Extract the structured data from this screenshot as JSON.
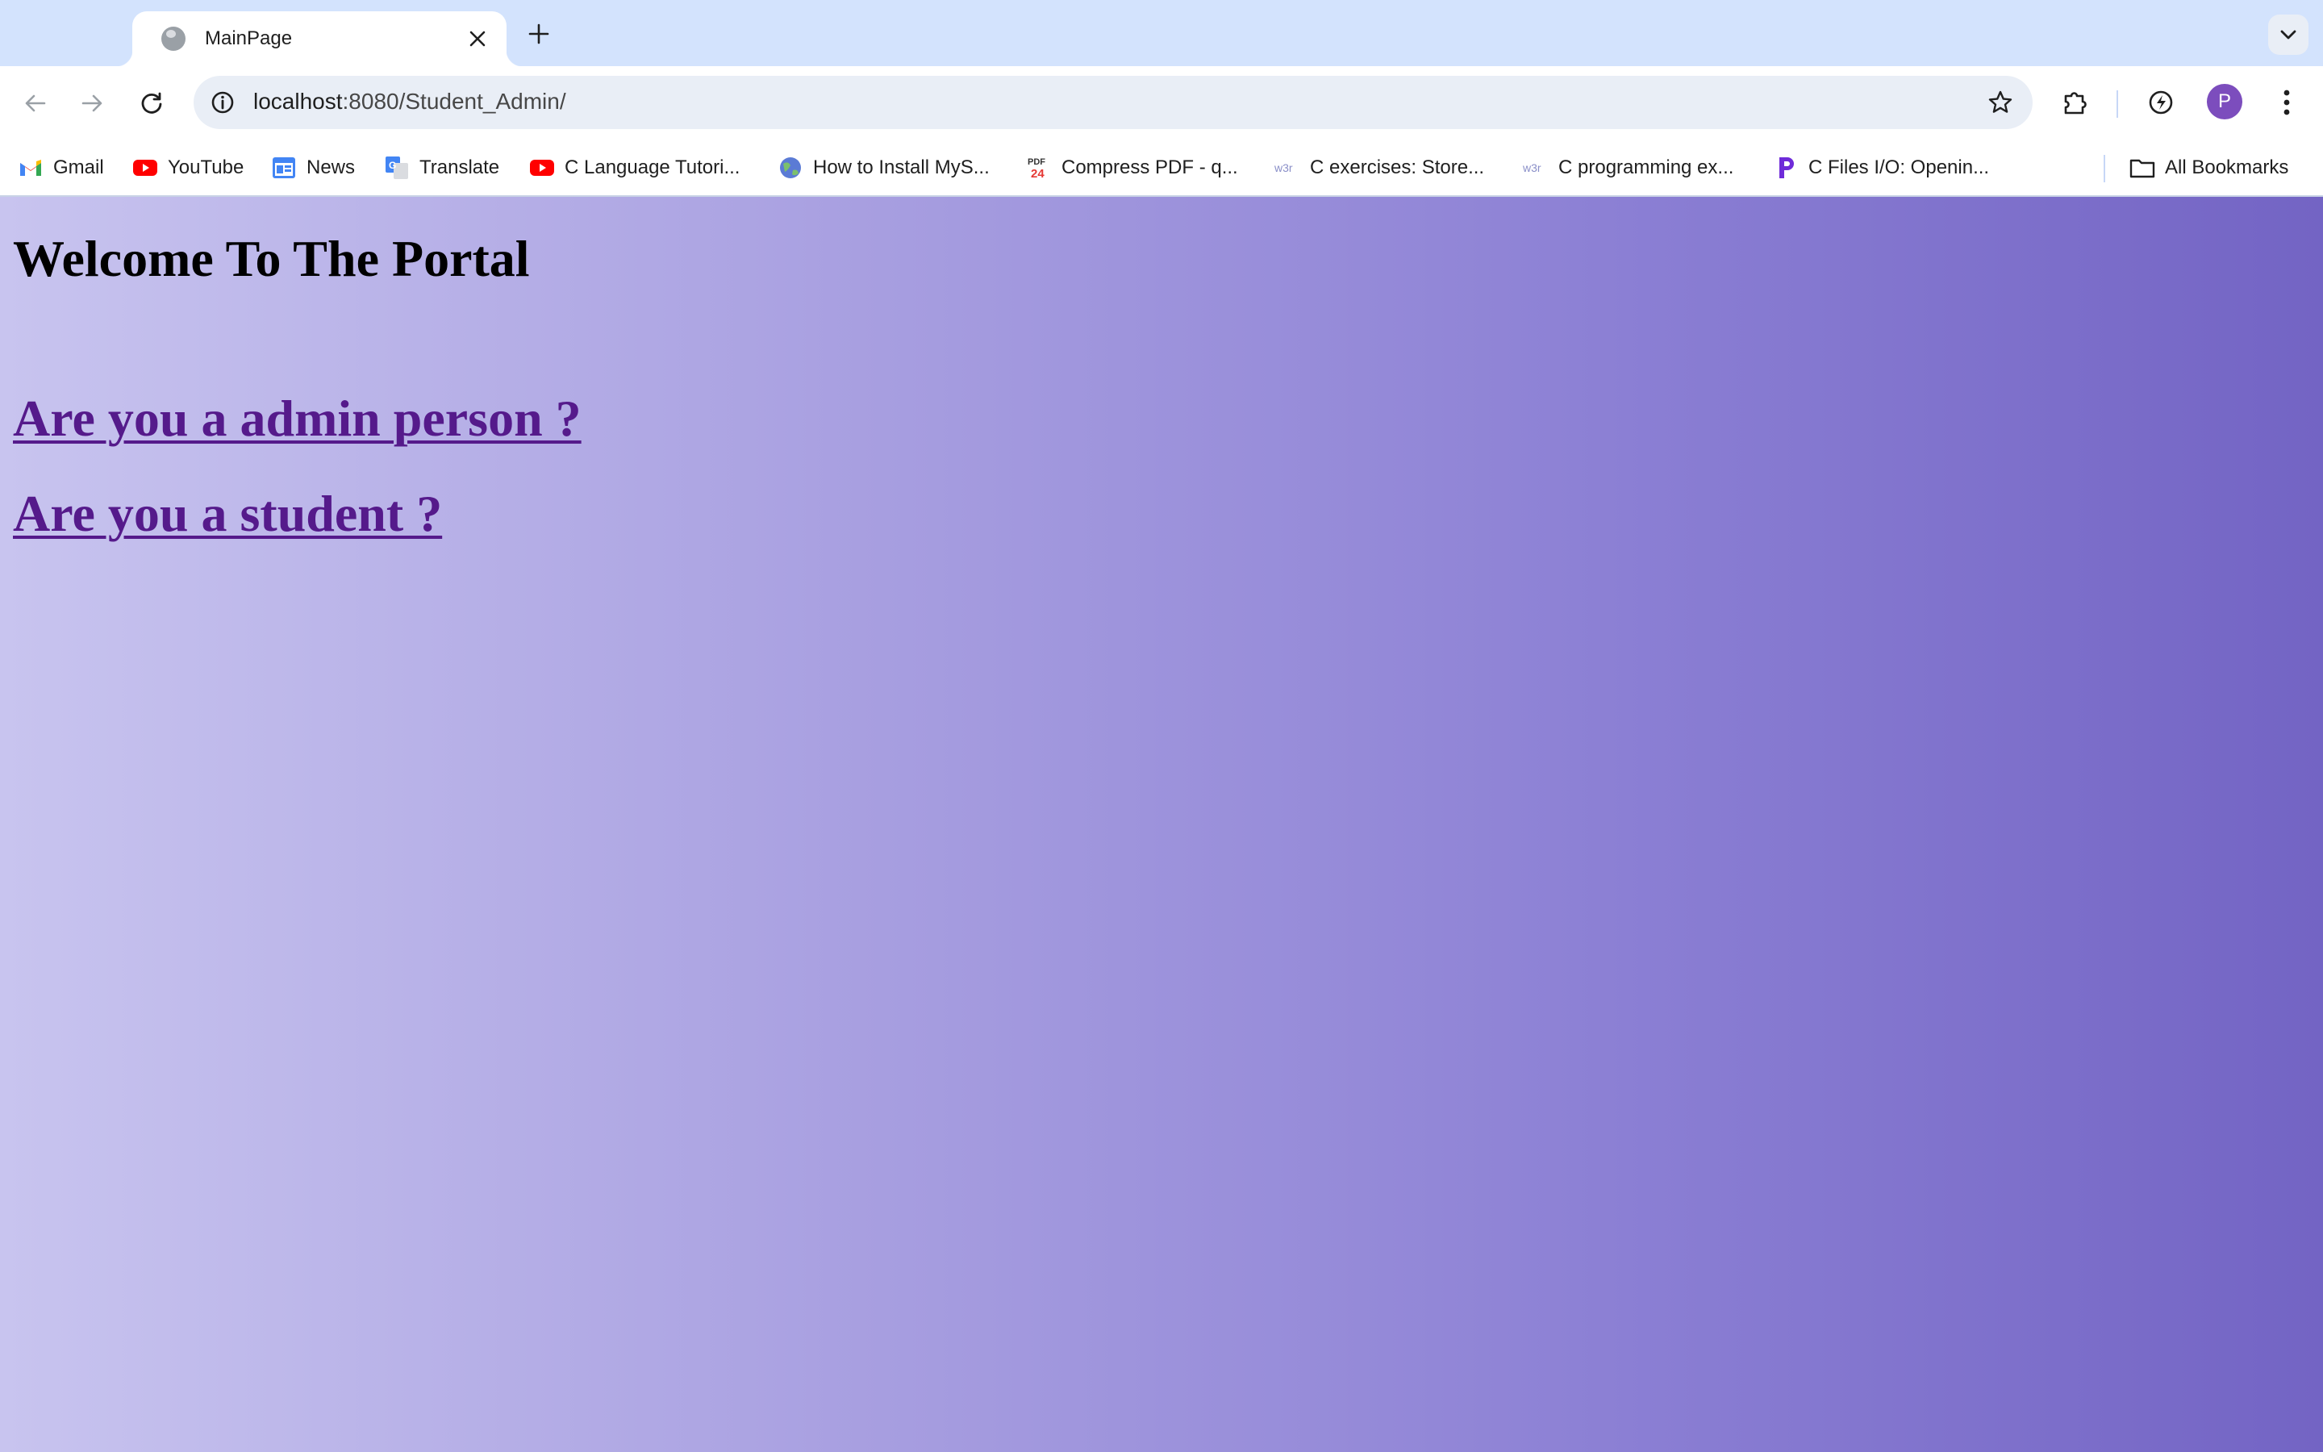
{
  "browser": {
    "tab": {
      "title": "MainPage"
    },
    "url": {
      "host": "localhost",
      "path": ":8080/Student_Admin/"
    },
    "profile_initial": "P",
    "bookmarks": [
      {
        "label": "Gmail",
        "icon": "gmail-icon"
      },
      {
        "label": "YouTube",
        "icon": "youtube-icon"
      },
      {
        "label": "News",
        "icon": "google-news-icon"
      },
      {
        "label": "Translate",
        "icon": "google-translate-icon"
      },
      {
        "label": "C Language Tutori...",
        "icon": "youtube-icon"
      },
      {
        "label": "How to Install MyS...",
        "icon": "globe-icon"
      },
      {
        "label": "Compress PDF - q...",
        "icon": "pdf24-icon"
      },
      {
        "label": "C exercises: Store...",
        "icon": "w3resource-icon"
      },
      {
        "label": "C programming ex...",
        "icon": "w3resource-icon"
      },
      {
        "label": "C Files I/O: Openin...",
        "icon": "programiz-icon"
      }
    ],
    "all_bookmarks": "All Bookmarks"
  },
  "page": {
    "heading": "Welcome To The Portal",
    "links": [
      {
        "label": "Are you a admin person ?"
      },
      {
        "label": "Are you a student ?"
      }
    ]
  },
  "colors": {
    "tabstrip": "#d3e3fd",
    "link_visited": "#551a8b",
    "gradient_start": "#c8c4ef",
    "gradient_end": "#7364c4"
  }
}
